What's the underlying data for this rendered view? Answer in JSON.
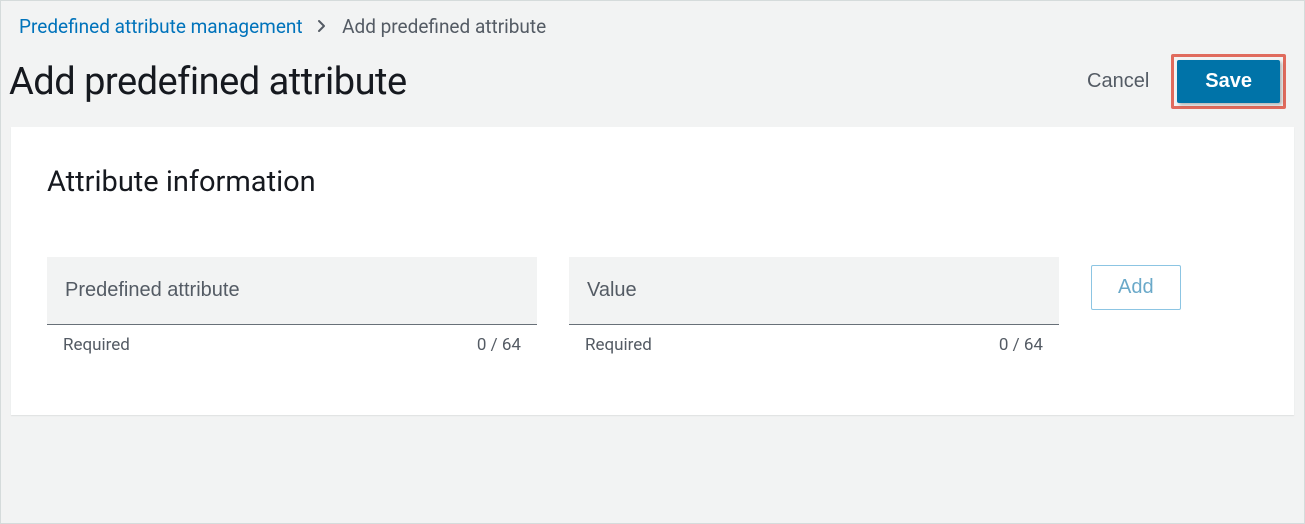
{
  "breadcrumb": {
    "parent": "Predefined attribute management",
    "current": "Add predefined attribute"
  },
  "page_title": "Add predefined attribute",
  "actions": {
    "cancel": "Cancel",
    "save": "Save"
  },
  "section": {
    "title": "Attribute information",
    "fields": {
      "attribute": {
        "placeholder": "Predefined attribute",
        "required_label": "Required",
        "counter": "0 / 64"
      },
      "value": {
        "placeholder": "Value",
        "required_label": "Required",
        "counter": "0 / 64"
      }
    },
    "add_label": "Add"
  }
}
